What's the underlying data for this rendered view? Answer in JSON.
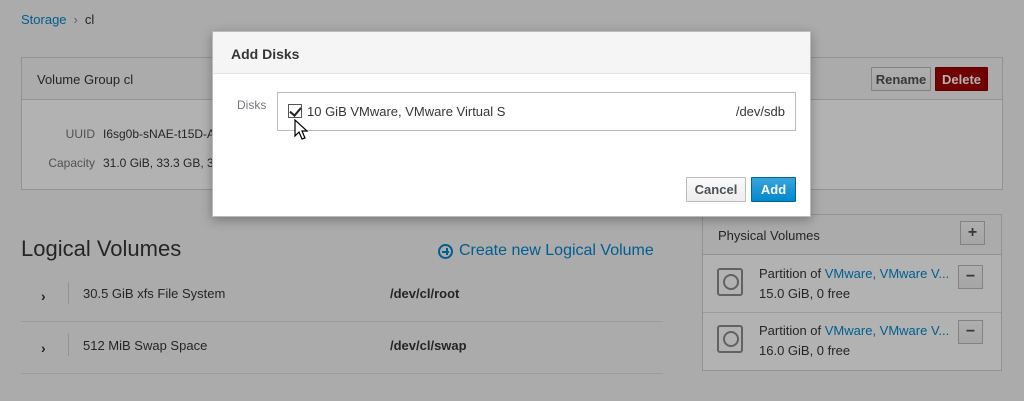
{
  "breadcrumb": {
    "root": "Storage",
    "separator": "›",
    "current": "cl"
  },
  "volume_group": {
    "title": "Volume Group cl",
    "rename_label": "Rename",
    "delete_label": "Delete",
    "uuid_label": "UUID",
    "uuid_value": "I6sg0b-sNAE-t15D-A",
    "capacity_label": "Capacity",
    "capacity_value": "31.0 GiB, 33.3 GB, 3"
  },
  "logical_volumes": {
    "title": "Logical Volumes",
    "create_label": "Create new Logical Volume",
    "rows": [
      {
        "name": "30.5 GiB xfs File System",
        "path": "/dev/cl/root"
      },
      {
        "name": "512 MiB Swap Space",
        "path": "/dev/cl/swap"
      }
    ]
  },
  "physical_volumes": {
    "title": "Physical Volumes",
    "add_symbol": "+",
    "remove_symbol": "−",
    "rows": [
      {
        "prefix": "Partition of ",
        "device": "VMware, VMware V...",
        "size": "15.0 GiB, 0 free"
      },
      {
        "prefix": "Partition of ",
        "device": "VMware, VMware V...",
        "size": "16.0 GiB, 0 free"
      }
    ]
  },
  "dialog": {
    "title": "Add Disks",
    "disks_label": "Disks",
    "disk": {
      "name": "10 GiB VMware, VMware Virtual S",
      "device": "/dev/sdb",
      "checked": true
    },
    "cancel_label": "Cancel",
    "add_label": "Add"
  },
  "colors": {
    "link": "#0088ce",
    "danger": "#a30000",
    "primary": "#0088ce"
  }
}
